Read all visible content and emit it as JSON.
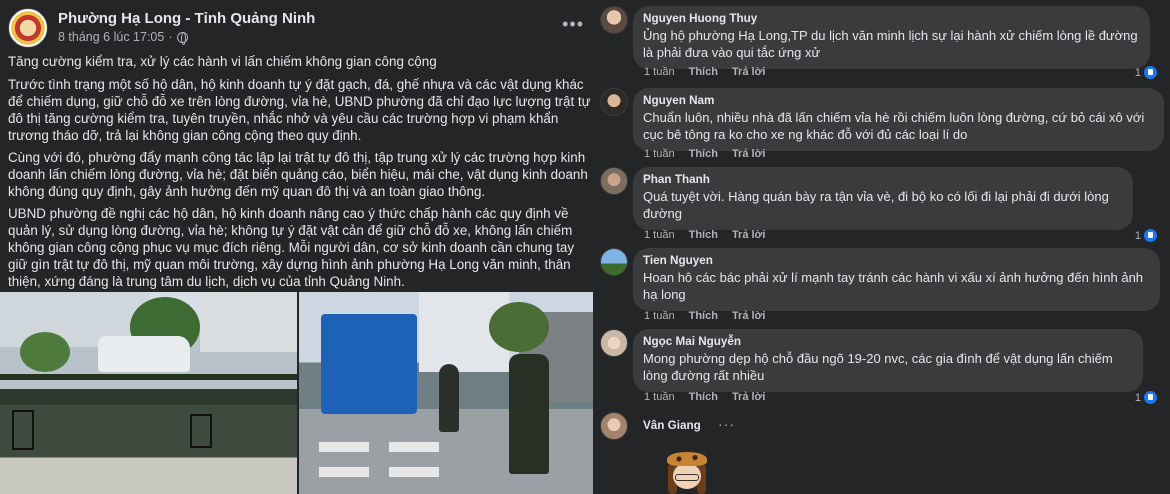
{
  "post": {
    "page_name": "Phường Hạ Long - Tỉnh Quảng Ninh",
    "timestamp": "8 tháng 6 lúc 17:05",
    "dot_separator": "·",
    "more_icon": "more-horizontal-icon",
    "privacy_icon": "globe-icon",
    "paragraphs": [
      "Tăng cường kiểm tra, xử lý các hành vi lấn chiếm không gian công cộng",
      "Trước tình trạng một số hộ dân, hộ kinh doanh tự ý đặt gạch, đá, ghế nhựa và các vật dụng khác để chiếm dụng, giữ chỗ đỗ xe trên lòng đường, vỉa hè, UBND phường đã chỉ đạo lực lượng trật tự đô thị tăng cường kiểm tra, tuyên truyền, nhắc nhở và yêu cầu các trường hợp vi phạm khẩn trương tháo dỡ, trả lại không gian công cộng theo quy định.",
      "Cùng với đó, phường đẩy mạnh công tác lập lại trật tự đô thị, tập trung xử lý các trường hợp kinh doanh lấn chiếm lòng đường, vỉa hè; đặt biển quảng cáo, biển hiệu, mái che, vật dụng kinh doanh không đúng quy định, gây ảnh hưởng đến mỹ quan đô thị và an toàn giao thông.",
      "UBND phường đề nghị các hộ dân, hộ kinh doanh nâng cao ý thức chấp hành các quy định về quản lý, sử dụng lòng đường, vỉa hè; không tự ý đặt vật cản để giữ chỗ đỗ xe, không lấn chiếm không gian công cộng phục vụ mục đích riêng. Mỗi người dân, cơ sở kinh doanh cần chung tay giữ gìn trật tự đô thị, mỹ quan môi trường, xây dựng hình ảnh phường Hạ Long văn minh, thân thiện, xứng đáng là trung tâm du lịch, dịch vụ của tỉnh Quảng Ninh."
    ]
  },
  "comments": [
    {
      "name": "Nguyen Huong Thuy",
      "text": "Ủng hộ phường Hạ Long,TP du lịch văn minh lịch sự lại hành xử chiếm lòng lề đường là phải đưa vào qui tắc ứng xử",
      "time": "1 tuần",
      "like": "Thích",
      "reply": "Trả lời",
      "reactions": "1"
    },
    {
      "name": "Nguyen Nam",
      "text": "Chuẩn luôn, nhiều nhà đã lấn chiếm vỉa hè rồi chiếm luôn lòng đường, cứ bỏ cái xô với cục bê tông ra ko cho xe ng khác đỗ với đủ các loại lí do",
      "time": "1 tuần",
      "like": "Thích",
      "reply": "Trả lời",
      "reactions": ""
    },
    {
      "name": "Phan Thanh",
      "text": "Quá tuyệt vời. Hàng quán bày ra tận vỉa vè, đi bộ ko có lối đi lại phải đi dưới lòng đường",
      "time": "1 tuần",
      "like": "Thích",
      "reply": "Trả lời",
      "reactions": "1"
    },
    {
      "name": "Tien Nguyen",
      "text": "Hoan hô các bác phải xử lí mạnh tay tránh các hành vi xấu xí ảnh hưởng đến hình ảnh hạ long",
      "time": "1 tuần",
      "like": "Thích",
      "reply": "Trả lời",
      "reactions": ""
    },
    {
      "name": "Ngọc Mai Nguyễn",
      "text": "Mong phường dẹp hộ chỗ đầu ngõ 19-20 nvc, các gia đình để vật dụng lấn chiếm lòng đường rất nhiều",
      "time": "1 tuần",
      "like": "Thích",
      "reply": "Trả lời",
      "reactions": "1"
    },
    {
      "name": "Vân Giang",
      "text": "",
      "time": "",
      "like": "",
      "reply": "",
      "reactions": "",
      "dots": "···"
    }
  ],
  "colors": {
    "background": "#242526",
    "bubble": "#3a3b3c",
    "text_primary": "#e4e6eb",
    "text_secondary": "#b0b3b8",
    "like_blue": "#1877f2"
  }
}
